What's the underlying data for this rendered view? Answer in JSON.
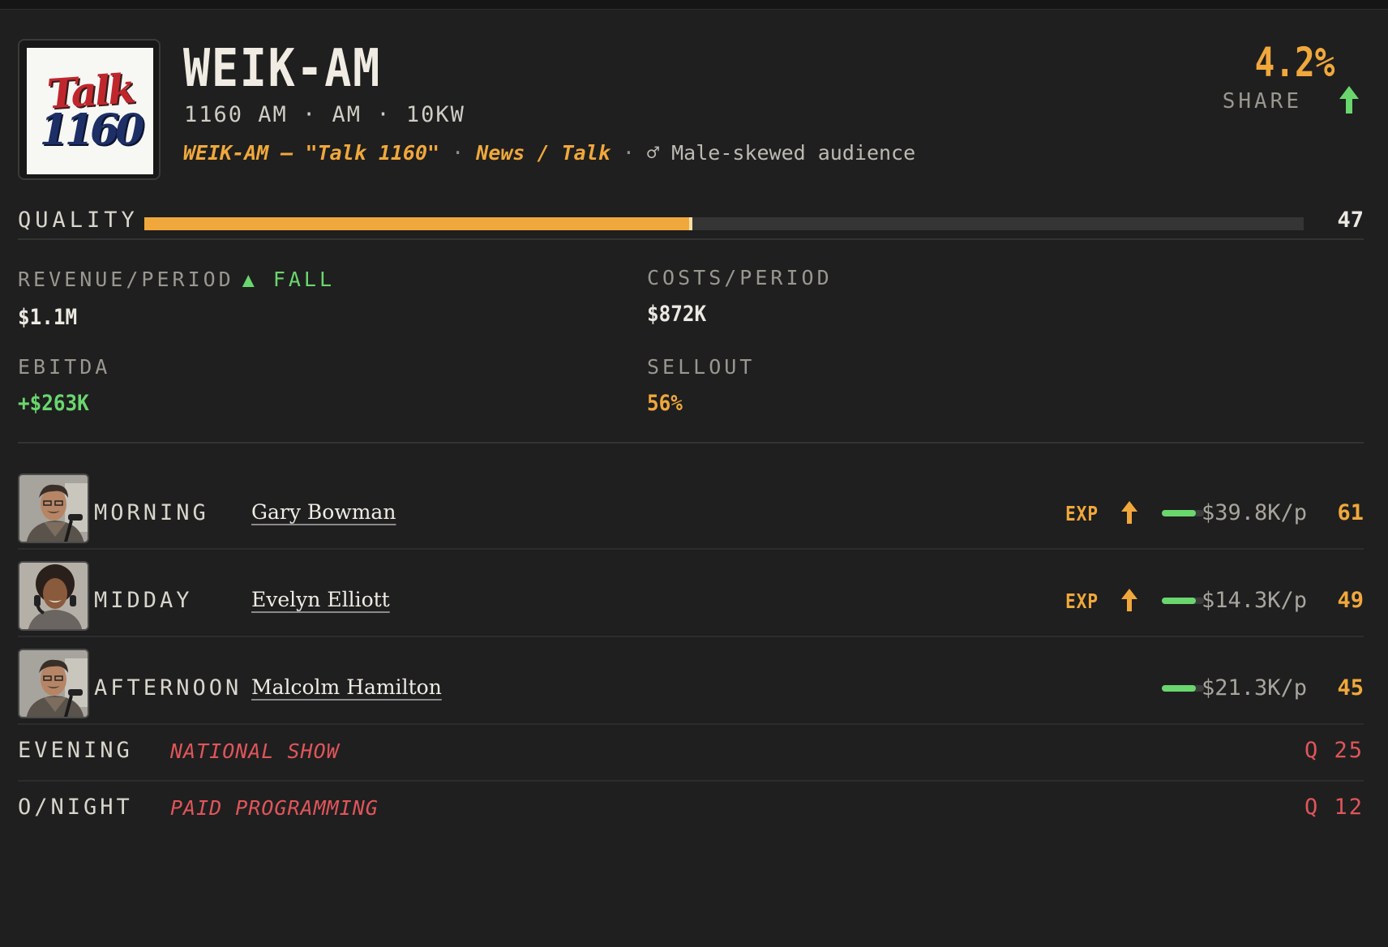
{
  "station": {
    "logo": {
      "line1": "Talk",
      "line2": "1160"
    },
    "call_sign": "WEIK-AM",
    "meta": "1160 AM · AM · 10KW",
    "description": {
      "name": "WEIK-AM — \"Talk 1160\"",
      "sep1": "·",
      "format": "News / Talk",
      "sep2": "·",
      "audience": "♂ Male-skewed audience"
    },
    "share": {
      "value": "4.2%",
      "label": "SHARE",
      "trend": "up"
    }
  },
  "quality": {
    "label": "QUALITY",
    "value": "47",
    "level": 0.47
  },
  "stats": {
    "revenue": {
      "label": "REVENUE/PERIOD",
      "trend": "▲ FALL",
      "value": "$1.1M"
    },
    "costs": {
      "label": "COSTS/PERIOD",
      "value": "$872K"
    },
    "ebitda": {
      "label": "EBITDA",
      "value": "+$263K"
    },
    "sellout": {
      "label": "SELLOUT",
      "value": "56%"
    }
  },
  "shifts": [
    {
      "slot": "MORNING",
      "host": "Gary Bowman",
      "exp": "EXP",
      "exp_arrow": "up",
      "bar_level": 0.8,
      "salary": "$39.8K/p",
      "score": "61"
    },
    {
      "slot": "MIDDAY",
      "host": "Evelyn Elliott",
      "exp": "EXP",
      "exp_arrow": "up",
      "bar_level": 0.8,
      "salary": "$14.3K/p",
      "score": "49"
    },
    {
      "slot": "AFTERNOON",
      "host": "Malcolm Hamilton",
      "bar_level": 0.8,
      "salary": "$21.3K/p",
      "score": "45"
    }
  ],
  "fill_shifts": [
    {
      "slot": "EVENING",
      "program": "NATIONAL SHOW",
      "quality": "Q 25"
    },
    {
      "slot": "O/NIGHT",
      "program": "PAID PROGRAMMING",
      "quality": "Q 12"
    }
  ],
  "colors": {
    "accent": "#f0a83c",
    "positive": "#6ad66e",
    "negative": "#e0555a",
    "background": "#1f1f1f"
  }
}
